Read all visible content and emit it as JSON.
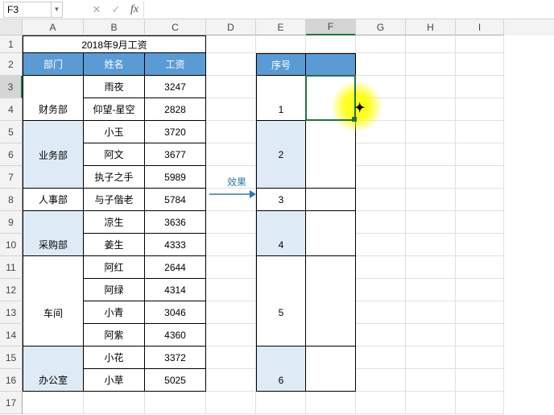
{
  "formula_bar": {
    "cell_ref": "F3",
    "fx_label": "fx",
    "value": ""
  },
  "col_headers": [
    "A",
    "B",
    "C",
    "D",
    "E",
    "F",
    "G",
    "H",
    "I"
  ],
  "row_numbers": [
    "1",
    "2",
    "3",
    "4",
    "5",
    "6",
    "7",
    "8",
    "9",
    "10",
    "11",
    "12",
    "13",
    "14",
    "15",
    "16",
    "17"
  ],
  "selected_col": "F",
  "selected_row": "3",
  "title": "2018年9月工资",
  "headers": {
    "dept": "部门",
    "name": "姓名",
    "salary": "工资",
    "seq": "序号"
  },
  "dept": {
    "fin": "财务部",
    "biz": "业务部",
    "hr": "人事部",
    "pur": "采购部",
    "shop": "车间",
    "off": "办公室"
  },
  "rows": [
    {
      "name": "雨夜",
      "salary": "3247"
    },
    {
      "name": "仰望-星空",
      "salary": "2828"
    },
    {
      "name": "小玉",
      "salary": "3720"
    },
    {
      "name": "阿文",
      "salary": "3677"
    },
    {
      "name": "执子之手",
      "salary": "5989"
    },
    {
      "name": "与子偕老",
      "salary": "5784"
    },
    {
      "name": "凉生",
      "salary": "3636"
    },
    {
      "name": "姜生",
      "salary": "4333"
    },
    {
      "name": "阿红",
      "salary": "2644"
    },
    {
      "name": "阿绿",
      "salary": "4314"
    },
    {
      "name": "小青",
      "salary": "3046"
    },
    {
      "name": "阿紫",
      "salary": "4360"
    },
    {
      "name": "小花",
      "salary": "3372"
    },
    {
      "name": "小草",
      "salary": "5025"
    }
  ],
  "seq": [
    "1",
    "2",
    "3",
    "4",
    "5",
    "6"
  ],
  "effect_label": "效果",
  "chart_data": {
    "type": "table",
    "title": "2018年9月工资",
    "columns": [
      "部门",
      "姓名",
      "工资"
    ],
    "rows": [
      [
        "财务部",
        "雨夜",
        3247
      ],
      [
        "财务部",
        "仰望-星空",
        2828
      ],
      [
        "业务部",
        "小玉",
        3720
      ],
      [
        "业务部",
        "阿文",
        3677
      ],
      [
        "业务部",
        "执子之手",
        5989
      ],
      [
        "人事部",
        "与子偕老",
        5784
      ],
      [
        "采购部",
        "凉生",
        3636
      ],
      [
        "采购部",
        "姜生",
        4333
      ],
      [
        "车间",
        "阿红",
        2644
      ],
      [
        "车间",
        "阿绿",
        4314
      ],
      [
        "车间",
        "小青",
        3046
      ],
      [
        "车间",
        "阿紫",
        4360
      ],
      [
        "办公室",
        "小花",
        3372
      ],
      [
        "办公室",
        "小草",
        5025
      ]
    ]
  }
}
